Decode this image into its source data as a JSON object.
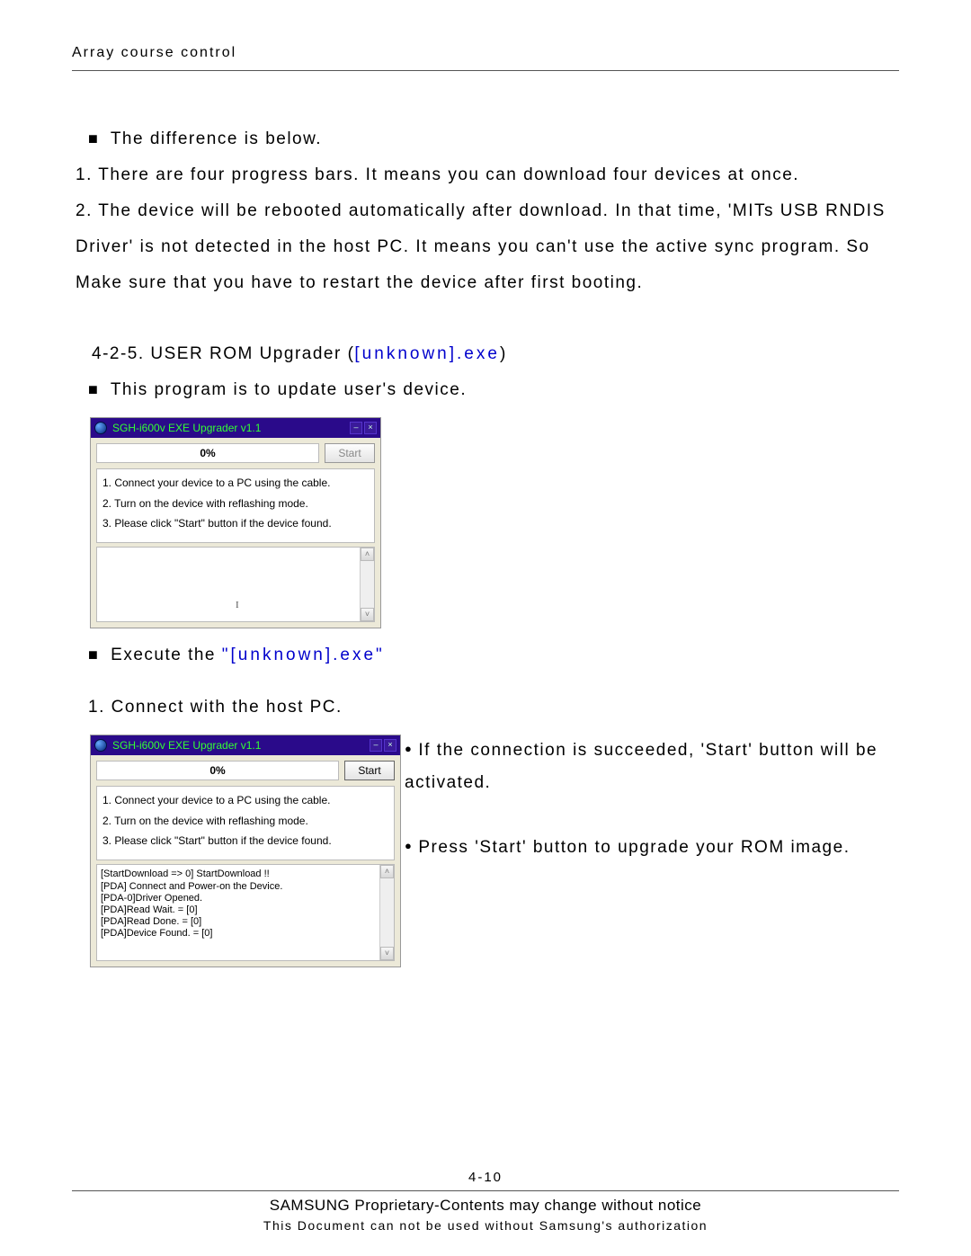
{
  "header": {
    "title": "Array course control"
  },
  "body": {
    "diff_heading": "The difference is below.",
    "point1": "1. There are four progress bars. It means you can download four devices at once.",
    "point2": "2. The device will be rebooted automatically after download. In that time, 'MITs USB RNDIS Driver' is not detected in the host PC. It means you can't use the active sync program. So Make sure that you have to restart the device after first booting.",
    "section_num": "4-2-5. USER ROM Upgrader (",
    "section_exe": "[unknown].exe",
    "section_close": ")",
    "section_desc": "This program is to update user's device.",
    "execute_lead": "Execute the ",
    "execute_exe": "\"[unknown].exe\"",
    "step1": "1. Connect with the host PC.",
    "side_bullet1": "If the connection is succeeded, 'Start' button will be activated.",
    "side_bullet2": "Press 'Start' button to upgrade your ROM image."
  },
  "win": {
    "title": "SGH-i600v EXE Upgrader v1.1",
    "progress": "0%",
    "start": "Start",
    "instr1": "1. Connect your device to a PC using the cable.",
    "instr2": "2. Turn on the device with reflashing mode.",
    "instr3": "3. Please click \"Start\" button if the device found.",
    "cursor": "I"
  },
  "log": {
    "l0": "[StartDownload => 0] StartDownload !!",
    "l1": "[PDA] Connect and Power-on the Device.",
    "l2": "[PDA-0]Driver Opened.",
    "l3": "[PDA]Read Wait. = [0]",
    "l4": "[PDA]Read Done. = [0]",
    "l5": "[PDA]Device Found. = [0]"
  },
  "footer": {
    "page": "4-10",
    "line1": "SAMSUNG Proprietary-Contents may change without notice",
    "line2": "This Document can not be used without Samsung's authorization"
  }
}
